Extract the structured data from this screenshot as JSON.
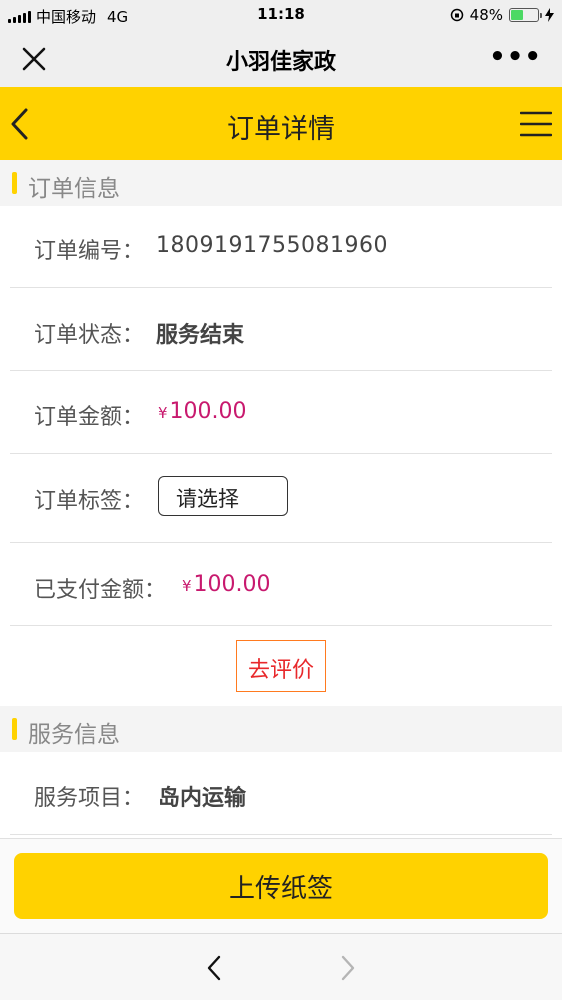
{
  "status_bar": {
    "carrier": "中国移动",
    "network": "4G",
    "time": "11:18",
    "battery_percent_label": "48%",
    "battery_level": 0.48
  },
  "wechat_bar": {
    "title": "小羽佳家政",
    "more_label": "•••"
  },
  "header": {
    "title": "订单详情"
  },
  "order_section": {
    "title": "订单信息",
    "fields": [
      {
        "label": "订单编号：",
        "value": "1809191755081960"
      },
      {
        "label": "订单状态：",
        "value": "服务结束"
      },
      {
        "label": "订单金额：",
        "currency": "¥",
        "value": "100.00"
      },
      {
        "label": "订单标签：",
        "value": "请选择"
      },
      {
        "label": "已支付金额：",
        "currency": "¥",
        "value": "100.00"
      }
    ],
    "review_button": "去评价"
  },
  "service_section": {
    "title": "服务信息",
    "fields": [
      {
        "label": "服务项目：",
        "value": "岛内运输"
      }
    ]
  },
  "upload_button": "上传纸签",
  "colors": {
    "brand_yellow": "#ffd200",
    "money": "#c8196e",
    "review_border": "#ff7a1f",
    "review_text": "#e8282b"
  },
  "icons": {
    "close": "close-icon",
    "back": "back-arrow-icon",
    "menu": "menu-icon",
    "nav_back": "nav-back-icon",
    "nav_forward": "nav-forward-icon"
  }
}
